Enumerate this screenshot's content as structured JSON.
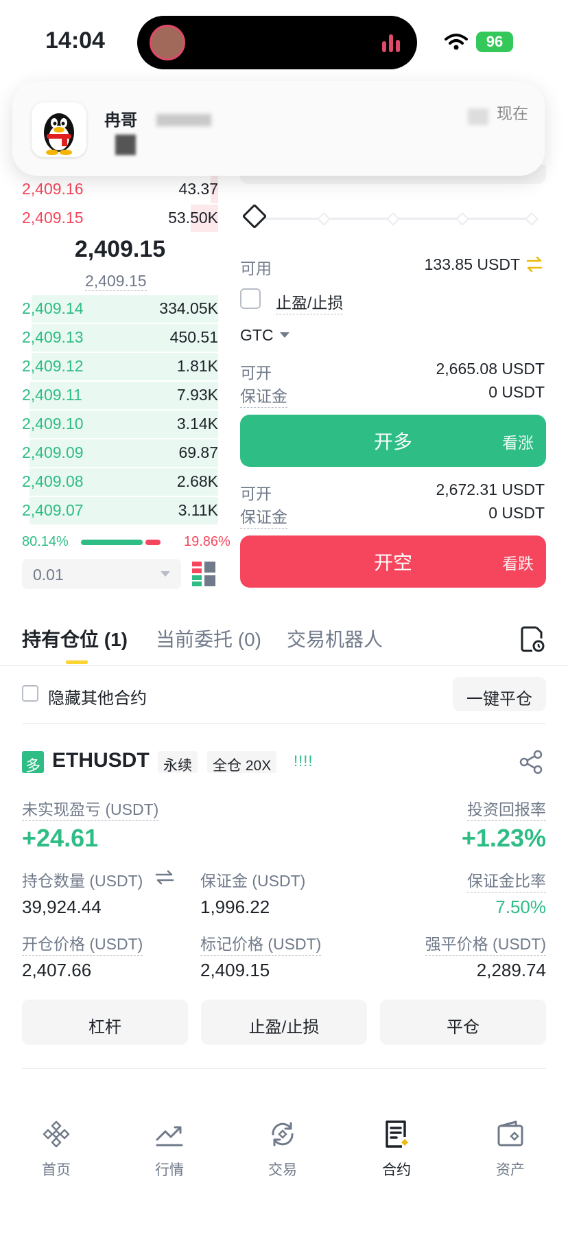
{
  "status_bar": {
    "time": "14:04",
    "battery": "96"
  },
  "notification": {
    "sender": "冉哥",
    "time": "现在"
  },
  "order_book": {
    "asks": [
      {
        "price": "2,409.16",
        "qty": "43.37",
        "depth": 0.04
      },
      {
        "price": "2,409.15",
        "qty": "53.50K",
        "depth": 0.14
      }
    ],
    "mid_price": "2,409.15",
    "mark_price": "2,409.15",
    "bids": [
      {
        "price": "2,409.14",
        "qty": "334.05K",
        "depth": 0.95
      },
      {
        "price": "2,409.13",
        "qty": "450.51",
        "depth": 0.95
      },
      {
        "price": "2,409.12",
        "qty": "1.81K",
        "depth": 0.95
      },
      {
        "price": "2,409.11",
        "qty": "7.93K",
        "depth": 0.96
      },
      {
        "price": "2,409.10",
        "qty": "3.14K",
        "depth": 0.96
      },
      {
        "price": "2,409.09",
        "qty": "69.87",
        "depth": 0.96
      },
      {
        "price": "2,409.08",
        "qty": "2.68K",
        "depth": 0.96
      },
      {
        "price": "2,409.07",
        "qty": "3.11K",
        "depth": 0.96
      }
    ],
    "buy_ratio": "80.14%",
    "sell_ratio": "19.86%",
    "precision": "0.01"
  },
  "order_form": {
    "available_label": "可用",
    "available_value": "133.85 USDT",
    "tpsl_label": "止盈/止损",
    "tif": "GTC",
    "long": {
      "open_label": "可开",
      "open_value": "2,665.08 USDT",
      "margin_label": "保证金",
      "margin_value": "0 USDT",
      "button": "开多",
      "side": "看涨"
    },
    "short": {
      "open_label": "可开",
      "open_value": "2,672.31 USDT",
      "margin_label": "保证金",
      "margin_value": "0 USDT",
      "button": "开空",
      "side": "看跌"
    }
  },
  "tabs": [
    {
      "label": "持有仓位 (1)"
    },
    {
      "label": "当前委托 (0)"
    },
    {
      "label": "交易机器人"
    }
  ],
  "positions": {
    "hide_others_label": "隐藏其他合约",
    "close_all_label": "一键平仓",
    "item": {
      "side_badge": "多",
      "symbol": "ETHUSDT",
      "type_tag": "永续",
      "margin_tag": "全仓 20X",
      "signal": "!!!!",
      "unrealized_label": "未实现盈亏 (USDT)",
      "unrealized_value": "+24.61",
      "roi_label": "投资回报率",
      "roi_value": "+1.23%",
      "size_label": "持仓数量 (USDT)",
      "size_value": "39,924.44",
      "margin_label": "保证金 (USDT)",
      "margin_value": "1,996.22",
      "margin_ratio_label": "保证金比率",
      "margin_ratio_value": "7.50%",
      "entry_label": "开仓价格 (USDT)",
      "entry_value": "2,407.66",
      "mark_label": "标记价格 (USDT)",
      "mark_value": "2,409.15",
      "liq_label": "强平价格 (USDT)",
      "liq_value": "2,289.74",
      "btn_leverage": "杠杆",
      "btn_tpsl": "止盈/止损",
      "btn_close": "平仓"
    }
  },
  "bottom_nav": [
    {
      "label": "首页",
      "icon": "home-icon"
    },
    {
      "label": "行情",
      "icon": "markets-icon"
    },
    {
      "label": "交易",
      "icon": "trade-icon"
    },
    {
      "label": "合约",
      "icon": "futures-icon"
    },
    {
      "label": "资产",
      "icon": "wallet-icon"
    }
  ],
  "colors": {
    "green": "#2ebd85",
    "red": "#f6465d",
    "accent": "#fcd535"
  }
}
